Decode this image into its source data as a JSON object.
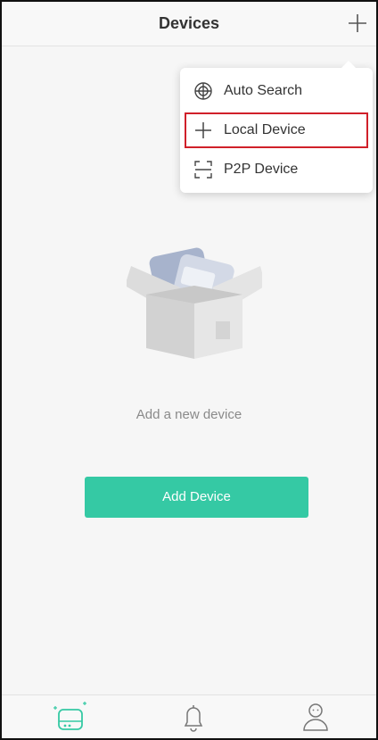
{
  "header": {
    "title": "Devices",
    "add_icon": "plus-icon"
  },
  "menu": {
    "items": [
      {
        "label": "Auto Search",
        "icon": "target-icon"
      },
      {
        "label": "Local Device",
        "icon": "plus-icon",
        "highlighted": true,
        "highlight_color": "#d0202a"
      },
      {
        "label": "P2P Device",
        "icon": "scan-frame-icon"
      }
    ]
  },
  "empty_state": {
    "illustration": "open-box-illustration",
    "message": "Add a new device",
    "button_label": "Add Device"
  },
  "tabbar": {
    "tabs": [
      {
        "name": "devices",
        "icon": "device-icon",
        "active": true
      },
      {
        "name": "alarms",
        "icon": "bell-icon",
        "active": false
      },
      {
        "name": "profile",
        "icon": "person-icon",
        "active": false
      }
    ]
  },
  "colors": {
    "accent": "#35c9a4",
    "highlight": "#d0202a",
    "text": "#333333",
    "muted": "#8a8a8a"
  }
}
